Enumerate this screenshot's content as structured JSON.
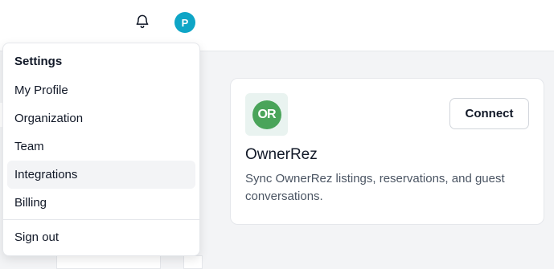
{
  "header": {
    "notifications_icon": "bell-icon",
    "avatar_initial": "P",
    "avatar_color": "#0ea5c6"
  },
  "menu": {
    "header": "Settings",
    "items": [
      {
        "label": "My Profile",
        "active": false
      },
      {
        "label": "Organization",
        "active": false
      },
      {
        "label": "Team",
        "active": false
      },
      {
        "label": "Integrations",
        "active": true
      },
      {
        "label": "Billing",
        "active": false
      }
    ],
    "sign_out": "Sign out"
  },
  "integration": {
    "logo_text": "OR",
    "logo_color": "#4aa45a",
    "name": "OwnerRez",
    "description": "Sync OwnerRez listings, reservations, and guest conversations.",
    "connect_label": "Connect"
  }
}
